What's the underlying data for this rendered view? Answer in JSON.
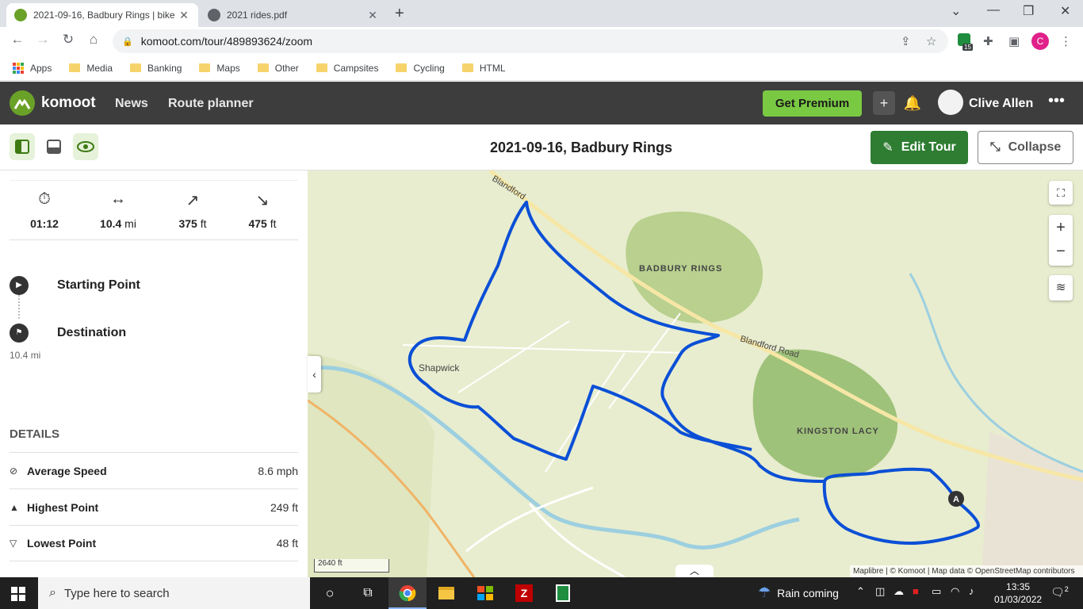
{
  "browser": {
    "tabs": [
      {
        "title": "2021-09-16, Badbury Rings | bike"
      },
      {
        "title": "2021 rides.pdf"
      }
    ],
    "url": "komoot.com/tour/489893624/zoom",
    "extension_badge": "15",
    "profile_initial": "C",
    "bookmarks": [
      "Apps",
      "Media",
      "Banking",
      "Maps",
      "Other",
      "Campsites",
      "Cycling",
      "HTML"
    ]
  },
  "app": {
    "brand": "komoot",
    "nav": [
      "News",
      "Route planner"
    ],
    "premium_label": "Get Premium",
    "user_name": "Clive Allen",
    "brand_color": "#6aa127"
  },
  "tour": {
    "title": "2021-09-16, Badbury Rings",
    "edit_label": "Edit Tour",
    "collapse_label": "Collapse",
    "stats": {
      "duration": "01:12",
      "distance_value": "10.4",
      "distance_unit": "mi",
      "uphill_value": "375",
      "uphill_unit": "ft",
      "downhill_value": "475",
      "downhill_unit": "ft"
    },
    "waypoints": {
      "start_label": "Starting Point",
      "destination_label": "Destination",
      "destination_distance": "10.4 mi"
    },
    "details": {
      "heading": "DETAILS",
      "rows": [
        {
          "label": "Average Speed",
          "value": "8.6 mph"
        },
        {
          "label": "Highest Point",
          "value": "249 ft"
        },
        {
          "label": "Lowest Point",
          "value": "48 ft"
        }
      ]
    }
  },
  "map": {
    "labels": {
      "badbury": "BADBURY RINGS",
      "kingston": "KINGSTON LACY",
      "shapwick": "Shapwick",
      "road1": "Blandford Road",
      "road2": "Blandford"
    },
    "start_marker": "A",
    "scale": "2640 ft",
    "attribution": "Maplibre | © Komoot | Map data © OpenStreetMap contributors",
    "route_color": "#0a4fd6"
  },
  "taskbar": {
    "search_placeholder": "Type here to search",
    "weather": "Rain coming",
    "time": "13:35",
    "date": "01/03/2022",
    "notification_count": "2"
  }
}
